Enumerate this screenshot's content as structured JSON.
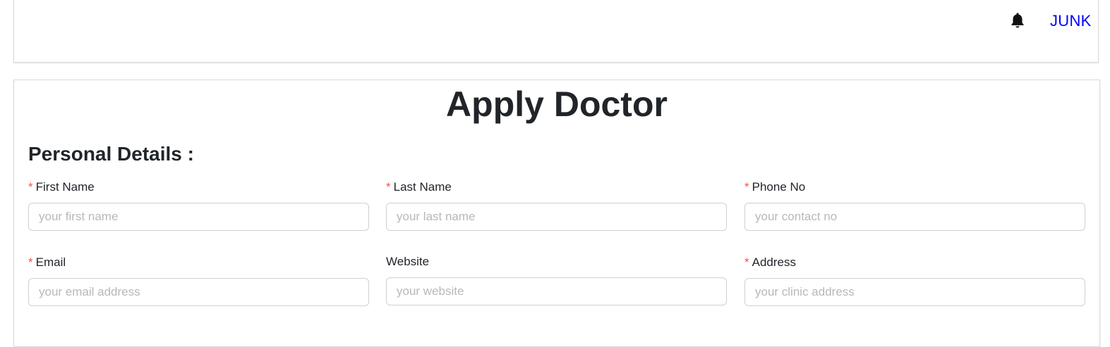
{
  "header": {
    "bell_icon": "bell-icon",
    "user_name": "JUNK",
    "user_link_color": "#0000ff"
  },
  "form": {
    "title": "Apply Doctor",
    "section_title": "Personal Details :",
    "required_marker": "*",
    "required_color": "#ff4d4f",
    "fields": [
      {
        "label": "First Name",
        "placeholder": "your first name",
        "value": "",
        "required": true
      },
      {
        "label": "Last Name",
        "placeholder": "your last name",
        "value": "",
        "required": true
      },
      {
        "label": "Phone No",
        "placeholder": "your contact no",
        "value": "",
        "required": true
      },
      {
        "label": "Email",
        "placeholder": "your email address",
        "value": "",
        "required": true
      },
      {
        "label": "Website",
        "placeholder": "your website",
        "value": "",
        "required": false
      },
      {
        "label": "Address",
        "placeholder": "your clinic address",
        "value": "",
        "required": true
      }
    ]
  }
}
